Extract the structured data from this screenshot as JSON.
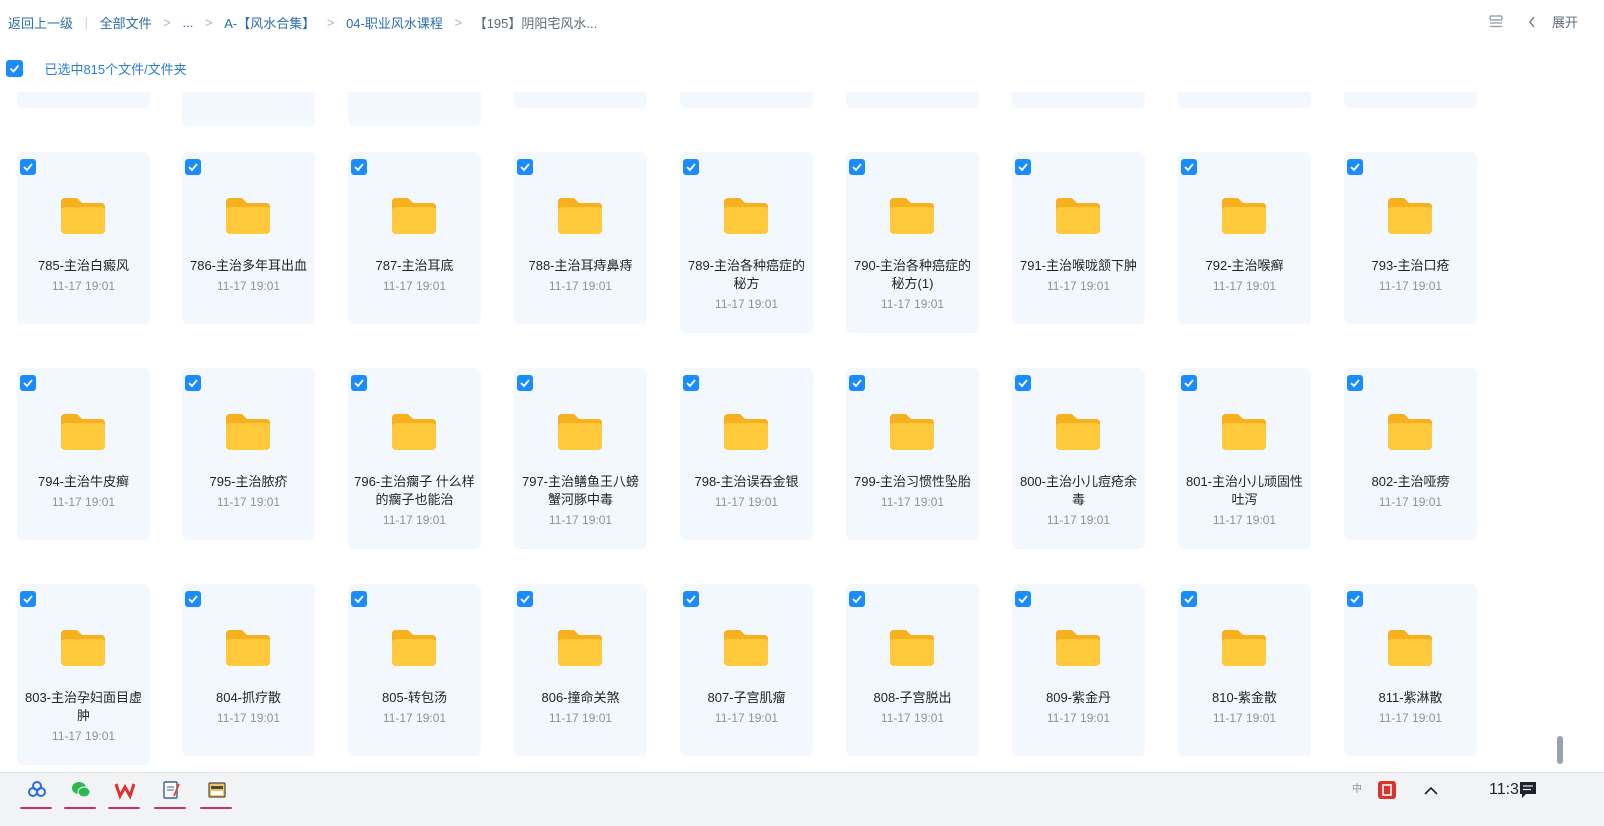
{
  "breadcrumb": {
    "back": "返回上一级",
    "all_files": "全部文件",
    "ellipsis": "...",
    "folder1": "A-【风水合集】",
    "folder2": "04-职业风水课程",
    "current": "【195】阴阳宅风水..."
  },
  "header_right": {
    "expand_label": "展开"
  },
  "selection": {
    "text": "已选中815个文件/文件夹"
  },
  "grid": {
    "items": [
      {
        "name": "785-主治白癜风",
        "time": "11-17 19:01"
      },
      {
        "name": "786-主治多年耳出血",
        "time": "11-17 19:01"
      },
      {
        "name": "787-主治耳底",
        "time": "11-17 19:01"
      },
      {
        "name": "788-主治耳痔鼻痔",
        "time": "11-17 19:01"
      },
      {
        "name": "789-主治各种癌症的秘方",
        "time": "11-17 19:01"
      },
      {
        "name": "790-主治各种癌症的秘方(1)",
        "time": "11-17 19:01"
      },
      {
        "name": "791-主治喉咙颔下肿",
        "time": "11-17 19:01"
      },
      {
        "name": "792-主治喉癣",
        "time": "11-17 19:01"
      },
      {
        "name": "793-主治口疮",
        "time": "11-17 19:01"
      },
      {
        "name": "794-主治牛皮癣",
        "time": "11-17 19:01"
      },
      {
        "name": "795-主治脓疥",
        "time": "11-17 19:01"
      },
      {
        "name": "796-主治瘸子 什么样的瘸子也能治",
        "time": "11-17 19:01"
      },
      {
        "name": "797-主治鳝鱼王八螃蟹河豚中毒",
        "time": "11-17 19:01"
      },
      {
        "name": "798-主治误吞金银",
        "time": "11-17 19:01"
      },
      {
        "name": "799-主治习惯性坠胎",
        "time": "11-17 19:01"
      },
      {
        "name": "800-主治小儿痘疮余毒",
        "time": "11-17 19:01"
      },
      {
        "name": "801-主治小儿顽固性吐泻",
        "time": "11-17 19:01"
      },
      {
        "name": "802-主治哑痨",
        "time": "11-17 19:01"
      },
      {
        "name": "803-主治孕妇面目虚肿",
        "time": "11-17 19:01"
      },
      {
        "name": "804-抓疗散",
        "time": "11-17 19:01"
      },
      {
        "name": "805-转包汤",
        "time": "11-17 19:01"
      },
      {
        "name": "806-撞命关煞",
        "time": "11-17 19:01"
      },
      {
        "name": "807-子宫肌瘤",
        "time": "11-17 19:01"
      },
      {
        "name": "808-子宫脱出",
        "time": "11-17 19:01"
      },
      {
        "name": "809-紫金丹",
        "time": "11-17 19:01"
      },
      {
        "name": "810-紫金散",
        "time": "11-17 19:01"
      },
      {
        "name": "811-紫淋散",
        "time": "11-17 19:01"
      }
    ]
  },
  "taskbar": {
    "apps": [
      {
        "icon": "baidu-netdisk-icon"
      },
      {
        "icon": "wechat-icon"
      },
      {
        "icon": "wps-office-icon"
      },
      {
        "icon": "notepad-icon"
      },
      {
        "icon": "file-manager-icon"
      }
    ],
    "ime_label": "中",
    "clock": "11:39"
  },
  "colors": {
    "accent": "#1a8cff",
    "link": "#2b6cb0",
    "tile_bg": "#f2f8fd",
    "folder": "#ffc93b",
    "folder_back": "#f7b01e"
  }
}
